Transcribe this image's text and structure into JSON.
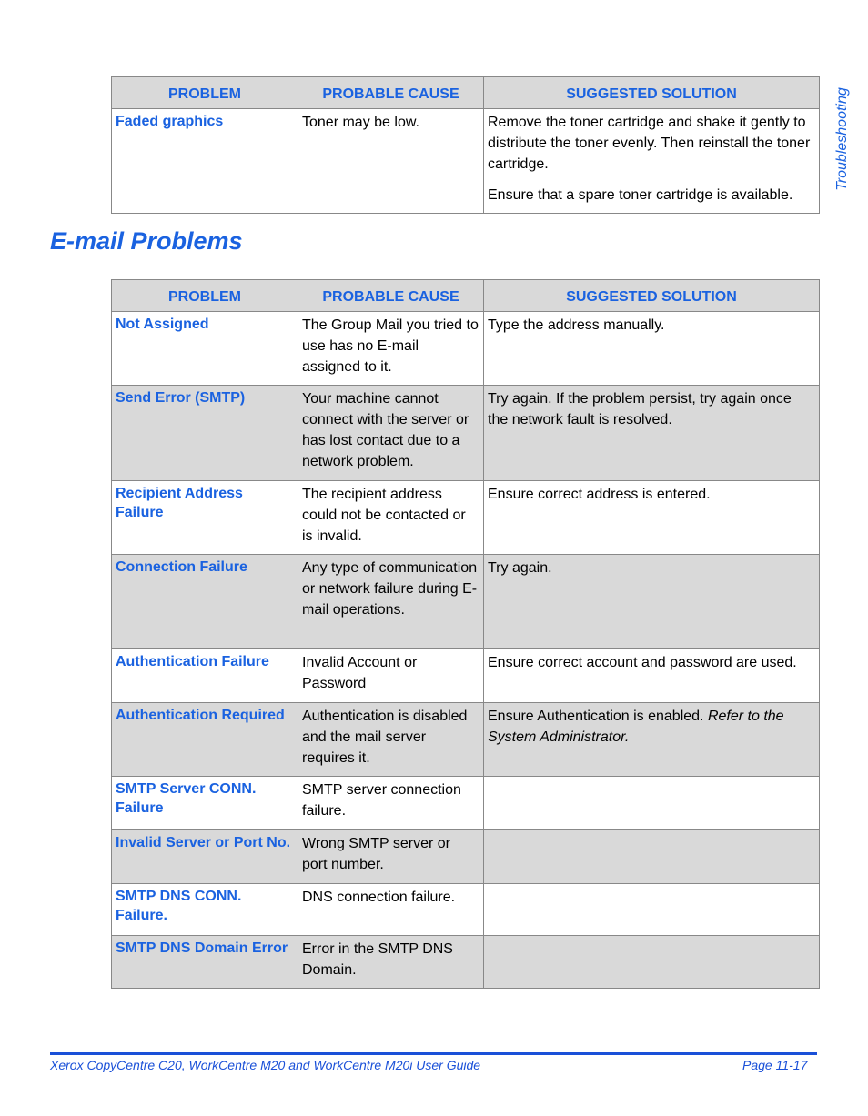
{
  "side_tab": {
    "label": "Troubleshooting"
  },
  "headers": {
    "problem": "PROBLEM",
    "cause": "PROBABLE CAUSE",
    "solution": "SUGGESTED SOLUTION"
  },
  "table1": {
    "rows": [
      {
        "problem": "Faded graphics",
        "cause": "Toner may be low.",
        "solution": [
          "Remove the toner cartridge and shake it gently to distribute the toner evenly. Then reinstall the toner cartridge.",
          "Ensure that a spare toner cartridge is available."
        ]
      }
    ]
  },
  "section": {
    "title": "E-mail Problems"
  },
  "table2": {
    "rows": [
      {
        "problem": "Not Assigned",
        "cause": "The Group Mail you tried to use has no E-mail assigned to it.",
        "solution": "Type the address manually."
      },
      {
        "problem": "Send Error (SMTP)",
        "cause": "Your machine cannot connect with the server or has lost contact due to a network problem.",
        "solution": "Try again. If the problem persist, try again once the network fault is resolved."
      },
      {
        "problem": "Recipient Address Failure",
        "cause": "The recipient address could not be contacted or is invalid.",
        "solution": "Ensure correct address is entered."
      },
      {
        "problem": "Connection Failure",
        "cause": "Any type of communication or network failure during E-mail operations.",
        "solution": "Try again."
      },
      {
        "problem": "Authentication Failure",
        "cause": "Invalid Account or Password",
        "solution": "Ensure correct account and password are used."
      },
      {
        "problem": "Authentication Required",
        "cause": "Authentication is disabled and the mail server requires it.",
        "solution": "Ensure Authentication is enabled.",
        "solution_italic": "Refer to the System Administrator."
      },
      {
        "problem": "SMTP Server CONN. Failure",
        "cause": "SMTP server connection failure.",
        "solution": ""
      },
      {
        "problem": "Invalid Server or Port No.",
        "cause": "Wrong SMTP server or port number.",
        "solution": ""
      },
      {
        "problem": "SMTP DNS CONN. Failure.",
        "cause": "DNS connection failure.",
        "solution": ""
      },
      {
        "problem": "SMTP DNS Domain Error",
        "cause": "Error in the SMTP DNS Domain.",
        "solution": ""
      }
    ]
  },
  "footer": {
    "title": "Xerox CopyCentre C20, WorkCentre M20 and WorkCentre M20i User Guide",
    "page": "Page 11-17"
  },
  "colors": {
    "accent": "#1a62e0",
    "header_bg": "#d9d9d9",
    "border": "#888888"
  }
}
